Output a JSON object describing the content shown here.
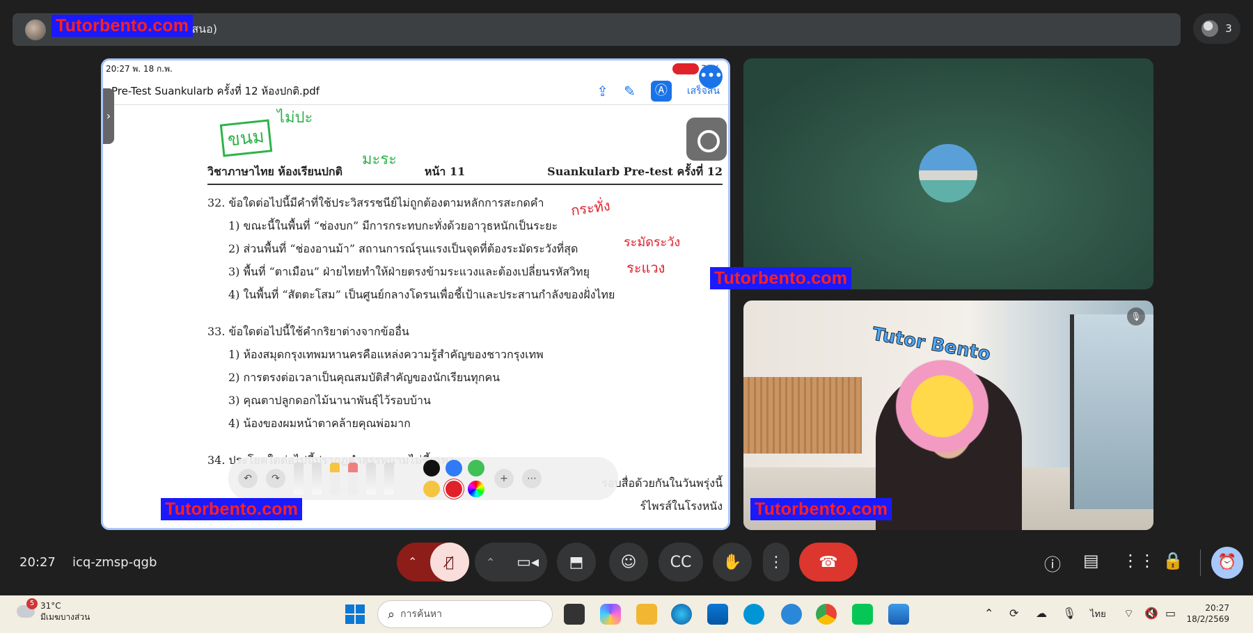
{
  "topbar": {
    "presenter_label": "นำเสนอ)",
    "watermark": "Tutorbento.com",
    "participant_count": "3"
  },
  "shared_screen": {
    "ipad_time": "20:27  พ. 18 ก.พ.",
    "battery": "36%",
    "file_name": "Pre-Test Suankularb ครั้งที่ 12 ห้องปกติ.pdf",
    "done_label": "เสร็จสิ้น",
    "doc_header_left": "วิชาภาษาไทย ห้องเรียนปกติ",
    "doc_header_mid": "หน้า 11",
    "doc_header_right": "Suankularb Pre-test ครั้งที่ 12",
    "questions": [
      {
        "text": "32.  ข้อใดต่อไปนี้มีคำที่ใช้ประวิสรรชนีย์ไม่ถูกต้องตามหลักการสะกดคำ",
        "options": [
          "1)  ขณะนี้ในพื้นที่ “ช่องบก” มีการกระทบกะทั่งด้วยอาวุธหนักเป็นระยะ",
          "2)  ส่วนพื้นที่ “ช่องอานม้า” สถานการณ์รุนแรงเป็นจุดที่ต้องระมัดระวังที่สุด",
          "3)  พื้นที่ “ตาเมือน” ฝ่ายไทยทำให้ฝ่ายตรงข้ามระแวงและต้องเปลี่ยนรหัสวิทยุ",
          "4)  ในพื้นที่ “สัตตะโสม” เป็นศูนย์กลางโดรนเพื่อชี้เป้าและประสานกำลังของฝั่งไทย"
        ]
      },
      {
        "text": "33.  ข้อใดต่อไปนี้ใช้คำกริยาต่างจากข้ออื่น",
        "options": [
          "1)  ห้องสมุดกรุงเทพมหานครคือแหล่งความรู้สำคัญของชาวกรุงเทพ",
          "2)  การตรงต่อเวลาเป็นคุณสมบัติสำคัญของนักเรียนทุกคน",
          "3)  คุณตาปลูกดอกไม้นานาพันธุ์ไว้รอบบ้าน",
          "4)  น้องของผมหน้าตาคล้ายคุณพ่อมาก"
        ]
      },
      {
        "text": "34.  ประโยคใดต่อไปนี้ปรากฏคำสรรพนามไม่ชี้เฉพาะ",
        "options": [
          "รอบสื่อด้วยกันในวันพรุ่งนี้",
          "ร์ไพรส์ในโรงหนัง"
        ]
      }
    ],
    "annotations": {
      "green_top": "ขนม",
      "green_top2": "ไม่ปะ",
      "green_mid": "มะระ",
      "red_1": "กระทั่ง",
      "red_2": "ระมัดระวัง",
      "red_3": "ระแวง"
    },
    "swatch_colors": [
      "#111111",
      "#2f7bf5",
      "#40c057",
      "#f5c542",
      "#e0222b",
      "#c0a0ff"
    ]
  },
  "tiles": {
    "sticker_title": "Tutor Bento"
  },
  "controls": {
    "time": "20:27",
    "meeting_code": "icq-zmsp-qgb"
  },
  "taskbar": {
    "weather_temp": "31°C",
    "weather_desc": "มีเมฆบางส่วน",
    "weather_badge": "5",
    "search_placeholder": "การค้นหา",
    "language": "ไทย",
    "clock_time": "20:27",
    "clock_date": "18/2/2569"
  }
}
